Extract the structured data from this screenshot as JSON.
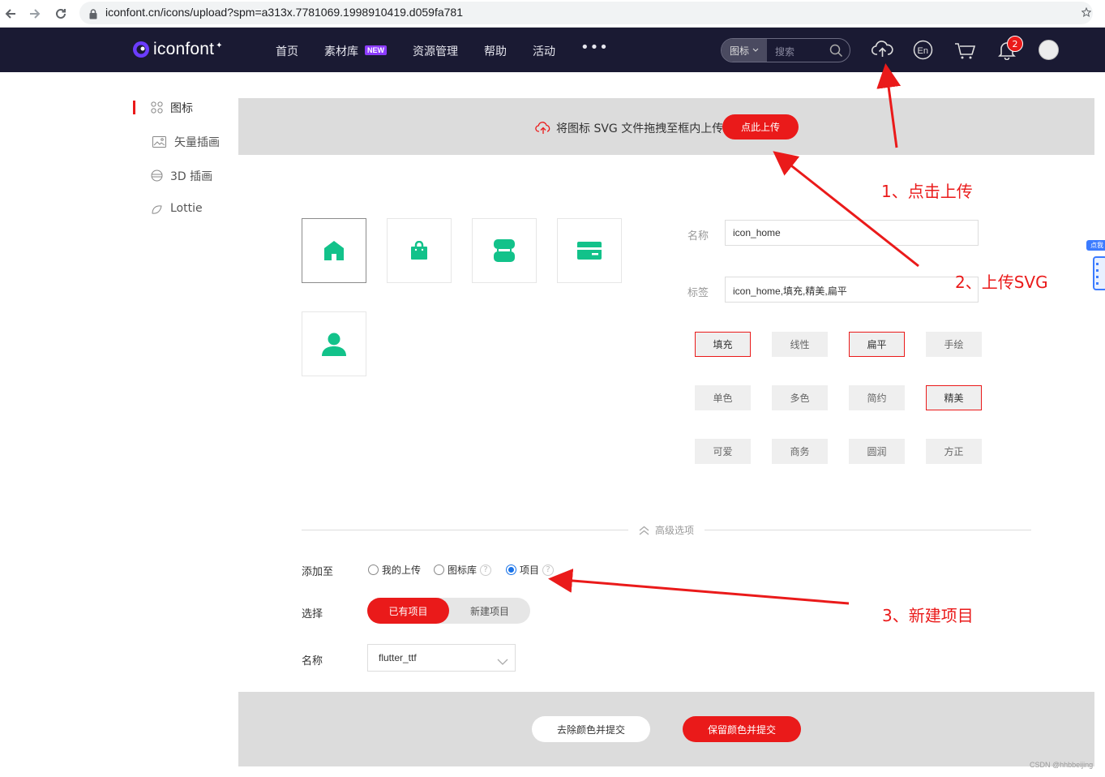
{
  "browser": {
    "url": "iconfont.cn/icons/upload?spm=a313x.7781069.1998910419.d059fa781"
  },
  "header": {
    "logo_text": "iconfont",
    "nav": [
      "首页",
      "素材库",
      "资源管理",
      "帮助",
      "活动"
    ],
    "new_badge": "NEW",
    "more": "•••",
    "search_type": "图标",
    "search_placeholder": "搜索",
    "notification_count": "2",
    "lang_icon_text": "En"
  },
  "sidebar": {
    "items": [
      {
        "label": "图标",
        "icon": "grid-icon",
        "active": true
      },
      {
        "label": "矢量插画",
        "icon": "image-icon",
        "active": false
      },
      {
        "label": "3D 插画",
        "icon": "sphere-icon",
        "active": false
      },
      {
        "label": "Lottie",
        "icon": "lottie-icon",
        "active": false
      }
    ]
  },
  "upload": {
    "hint": "将图标 SVG 文件拖拽至框内上传",
    "button": "点此上传"
  },
  "icons": [
    {
      "name": "home-icon",
      "selected": true
    },
    {
      "name": "bag-icon",
      "selected": false
    },
    {
      "name": "store-icon",
      "selected": false
    },
    {
      "name": "card-icon",
      "selected": false
    },
    {
      "name": "user-icon",
      "selected": false
    }
  ],
  "icon_color": "#12c28a",
  "form": {
    "name_label": "名称",
    "name_value": "icon_home",
    "tags_label": "标签",
    "tags_value": "icon_home,填充,精美,扁平"
  },
  "tags": [
    {
      "label": "填充",
      "active": true
    },
    {
      "label": "线性",
      "active": false
    },
    {
      "label": "扁平",
      "active": true
    },
    {
      "label": "手绘",
      "active": false
    },
    {
      "label": "单色",
      "active": false
    },
    {
      "label": "多色",
      "active": false
    },
    {
      "label": "简约",
      "active": false
    },
    {
      "label": "精美",
      "active": true
    },
    {
      "label": "可爱",
      "active": false
    },
    {
      "label": "商务",
      "active": false
    },
    {
      "label": "圆润",
      "active": false
    },
    {
      "label": "方正",
      "active": false
    }
  ],
  "advanced": {
    "toggle_label": "高级选项",
    "add_to_label": "添加至",
    "radio_options": [
      {
        "label": "我的上传",
        "checked": false,
        "help": false
      },
      {
        "label": "图标库",
        "checked": false,
        "help": true
      },
      {
        "label": "项目",
        "checked": true,
        "help": true
      }
    ],
    "select_label": "选择",
    "existing_project": "已有项目",
    "new_project": "新建项目",
    "project_name_label": "名称",
    "project_name_value": "flutter_ttf"
  },
  "footer": {
    "remove_color": "去除颜色并提交",
    "keep_color": "保留颜色并提交"
  },
  "annotations": {
    "step1": "1、点击上传",
    "step2": "2、上传SVG",
    "step3": "3、新建项目"
  },
  "side_widget_label": "点我",
  "watermark": "CSDN @hhbbeijing",
  "accent_color": "#ea1a1a"
}
